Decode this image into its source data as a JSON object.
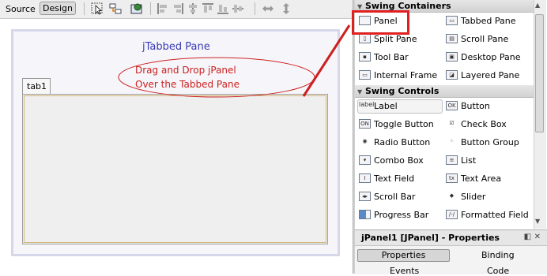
{
  "toolbar": {
    "source_label": "Source",
    "design_label": "Design"
  },
  "design": {
    "tabbed_pane_label": "jTabbed Pane",
    "tab_label": "tab1",
    "annotation_line1": "Drag and Drop jPanel",
    "annotation_line2": "Over the Tabbed Pane"
  },
  "palette": {
    "containers_header": "Swing Containers",
    "controls_header": "Swing Controls",
    "containers": [
      {
        "label": "Panel",
        "icon": "panel-icon"
      },
      {
        "label": "Tabbed Pane",
        "icon": "tabbed-pane-icon"
      },
      {
        "label": "Split Pane",
        "icon": "split-pane-icon"
      },
      {
        "label": "Scroll Pane",
        "icon": "scroll-pane-icon"
      },
      {
        "label": "Tool Bar",
        "icon": "toolbar-icon"
      },
      {
        "label": "Desktop Pane",
        "icon": "desktop-pane-icon"
      },
      {
        "label": "Internal Frame",
        "icon": "internal-frame-icon"
      },
      {
        "label": "Layered Pane",
        "icon": "layered-pane-icon"
      }
    ],
    "controls": [
      {
        "label": "Label",
        "icon": "label-icon",
        "icon_text": "label"
      },
      {
        "label": "Button",
        "icon": "button-icon",
        "icon_text": "OK"
      },
      {
        "label": "Toggle Button",
        "icon": "toggle-button-icon",
        "icon_text": "ON"
      },
      {
        "label": "Check Box",
        "icon": "check-box-icon"
      },
      {
        "label": "Radio Button",
        "icon": "radio-button-icon"
      },
      {
        "label": "Button Group",
        "icon": "button-group-icon"
      },
      {
        "label": "Combo Box",
        "icon": "combo-box-icon"
      },
      {
        "label": "List",
        "icon": "list-icon"
      },
      {
        "label": "Text Field",
        "icon": "text-field-icon"
      },
      {
        "label": "Text Area",
        "icon": "text-area-icon",
        "icon_text": "tx"
      },
      {
        "label": "Scroll Bar",
        "icon": "scroll-bar-icon"
      },
      {
        "label": "Slider",
        "icon": "slider-icon"
      },
      {
        "label": "Progress Bar",
        "icon": "progress-bar-icon"
      },
      {
        "label": "Formatted Field",
        "icon": "formatted-field-icon"
      }
    ]
  },
  "properties": {
    "title": "jPanel1 [JPanel] - Properties",
    "tabs": {
      "properties": "Properties",
      "binding": "Binding",
      "events": "Events",
      "code": "Code"
    }
  },
  "colors": {
    "annotation": "#cc2020",
    "highlight": "#e02020",
    "tabbed_label": "#3a3ab5"
  }
}
